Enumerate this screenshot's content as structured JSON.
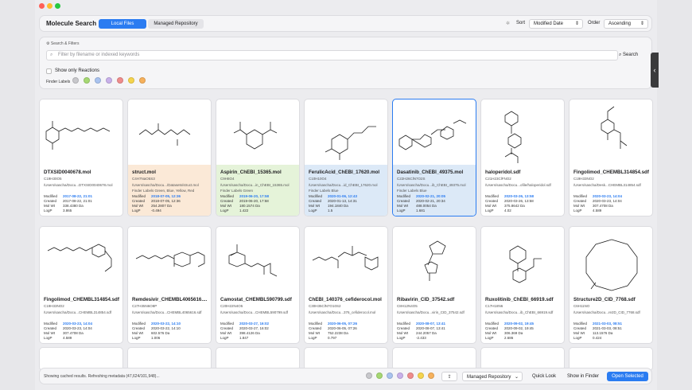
{
  "header": {
    "title": "Molecule Search",
    "tab_local": "Local Files",
    "tab_repo": "Managed Repository",
    "sort_label": "Sort",
    "sort_value": "Modified Date",
    "order_label": "Order",
    "order_value": "Ascending"
  },
  "filters": {
    "section": "Search & Filters",
    "placeholder": "Filter by filename or indexed keywords",
    "search_button": "Search",
    "only_reactions": "Show only Reactions",
    "finder_labels": "Finder Labels"
  },
  "label_colors": [
    "#c8c8cc",
    "#a6d873",
    "#a9c3ef",
    "#c9b1ea",
    "#ef8c8c",
    "#f5d44d",
    "#f6b15c"
  ],
  "cards": [
    {
      "name": "DTXSID0040678.mol",
      "formula": "C19H30O5",
      "path": "/Users/sascha/Docu...DTXSID0040678.mol",
      "labels": "",
      "modified": "2017-08-22, 21:01",
      "created": "2017-08-22, 21:01",
      "molwt": "338.4380 Da",
      "logp": "3.865"
    },
    {
      "name": "struct.mol",
      "formula": "C4H7NaO5S3",
      "path": "/Users/sascha/Docu.../Datasets/struct.mol",
      "labels": "Finder Labels Green, Blue, Yellow, Red",
      "modified": "2018-07-05, 12:36",
      "created": "2018-07-05, 12:36",
      "molwt": "254.2807 Da",
      "logp": "-0.494"
    },
    {
      "name": "Aspirin_ChEBI_15365.mol",
      "formula": "C9H8O4",
      "path": "/Users/sascha/Docu...in_ChEBI_15365.mol",
      "labels": "Finder Labels Green",
      "modified": "2019-06-20, 17:58",
      "created": "2019-06-20, 17:58",
      "molwt": "180.1574 Da",
      "logp": "1.422"
    },
    {
      "name": "FerulicAcid_ChEBI_17620.mol",
      "formula": "C10H10O4",
      "path": "/Users/sascha/Docu...id_ChEBI_17620.mol",
      "labels": "Finder Labels Blue",
      "modified": "2020-01-06, 12:43",
      "created": "2020-01-13, 14:31",
      "molwt": "194.1840 Da",
      "logp": "1.5"
    },
    {
      "name": "Dasatinib_ChEBI_49375.mol",
      "formula": "C22H26ClN7O2S",
      "path": "/Users/sascha/Docu...ib_ChEBI_49375.mol",
      "labels": "Finder Labels Blue",
      "modified": "2020-02-21, 20:05",
      "created": "2020-02-21, 20:34",
      "molwt": "488.0054 Da",
      "logp": "1.681"
    },
    {
      "name": "haloperidol.sdf",
      "formula": "C21H23ClFNO2",
      "path": "/Users/sascha/Docu...ofile/haloperidol.sdf",
      "labels": "",
      "modified": "2020-03-26, 13:58",
      "created": "2020-03-26, 13:58",
      "molwt": "375.8642 Da",
      "logp": "4.02"
    },
    {
      "name": "Fingolimod_CHEMBL314854.sdf",
      "formula": "C19H33NO2",
      "path": "/Users/sascha/Desk...CHEMBL314854.sdf",
      "labels": "",
      "modified": "2020-03-23, 14:04",
      "created": "2020-03-23, 14:04",
      "molwt": "307.4708 Da",
      "logp": "4.589"
    },
    {
      "name": "Fingolimod_CHEMBL314854.sdf",
      "formula": "C19H33NO2",
      "path": "/Users/sascha/Docu...CHEMBL314854.sdf",
      "labels": "",
      "modified": "2020-03-23, 14:04",
      "created": "2020-03-23, 14:04",
      "molwt": "307.4708 Da",
      "logp": "4.589"
    },
    {
      "name": "Remdesivir_CHEMBL4065616....",
      "formula": "C27H35N6O8P",
      "path": "/Users/sascha/Docu...CHEMBL4065616.sdf",
      "labels": "",
      "modified": "2020-03-22, 14:10",
      "created": "2020-03-22, 14:10",
      "molwt": "602.576 Da",
      "logp": "1.006"
    },
    {
      "name": "Camostat_CHEMBL590799.sdf",
      "formula": "C20H22N4O5",
      "path": "/Users/sascha/Docu...CHEMBL590799.sdf",
      "labels": "",
      "modified": "2020-03-27, 16:02",
      "created": "2020-03-27, 16:02",
      "molwt": "398.4126 Da",
      "logp": "1.847"
    },
    {
      "name": "ChEBI_140376_cefiderocol.mol",
      "formula": "C30H35ClN7O10S2",
      "path": "/Users/sascha/Docu...376_cefiderocol.mol",
      "labels": "",
      "modified": "2020-06-05, 07:26",
      "created": "2020-06-05, 07:26",
      "molwt": "752.2238 Da",
      "logp": "0.797"
    },
    {
      "name": "Ribavirin_CID_37542.sdf",
      "formula": "C8H12N4O5",
      "path": "/Users/sascha/Docu...virin_CID_37542.sdf",
      "labels": "",
      "modified": "2020-08-07, 13:41",
      "created": "2020-08-07, 13:41",
      "molwt": "244.2057 Da",
      "logp": "-2.433"
    },
    {
      "name": "Ruxolitinib_ChEBI_66919.sdf",
      "formula": "C17H18N6",
      "path": "/Users/sascha/Docu...ib_ChEBI_66919.sdf",
      "labels": "",
      "modified": "2020-09-02, 19:45",
      "created": "2020-09-02, 19:45",
      "molwt": "306.369 Da",
      "logp": "2.686"
    },
    {
      "name": "Structure2D_CID_7768.sdf",
      "formula": "C6H11NO",
      "path": "/Users/sascha/Docu...re2D_CID_7768.sdf",
      "labels": "",
      "modified": "2021-03-03, 08:51",
      "created": "2021-03-03, 08:51",
      "molwt": "113.1576 Da",
      "logp": "0.424"
    }
  ],
  "meta_labels": {
    "modified": "Modified",
    "created": "Created",
    "molwt": "Mol Wt",
    "logp": "LogP"
  },
  "footer": {
    "status": "Showing cached results. Refreshing metadata (47,624/101,948)...",
    "repo": "Managed Repository",
    "quick_look": "Quick Look",
    "show_finder": "Show in Finder",
    "open_selected": "Open Selected"
  }
}
